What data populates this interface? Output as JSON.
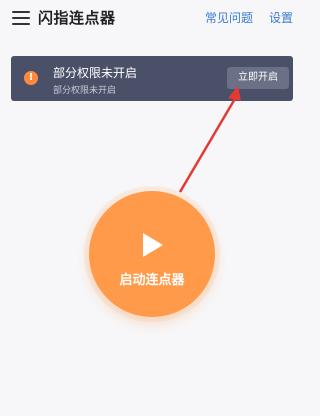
{
  "header": {
    "title": "闪指连点器",
    "faq_label": "常见问题",
    "settings_label": "设置"
  },
  "notice": {
    "icon_text": "!",
    "title": "部分权限未开启",
    "subtitle": "部分权限未开启",
    "button_label": "立即开启"
  },
  "main": {
    "start_label": "启动连点器"
  },
  "colors": {
    "accent": "#ff9a4a",
    "notice_bg": "#4a5068",
    "link": "#3a7bd5",
    "arrow": "#e53935"
  }
}
